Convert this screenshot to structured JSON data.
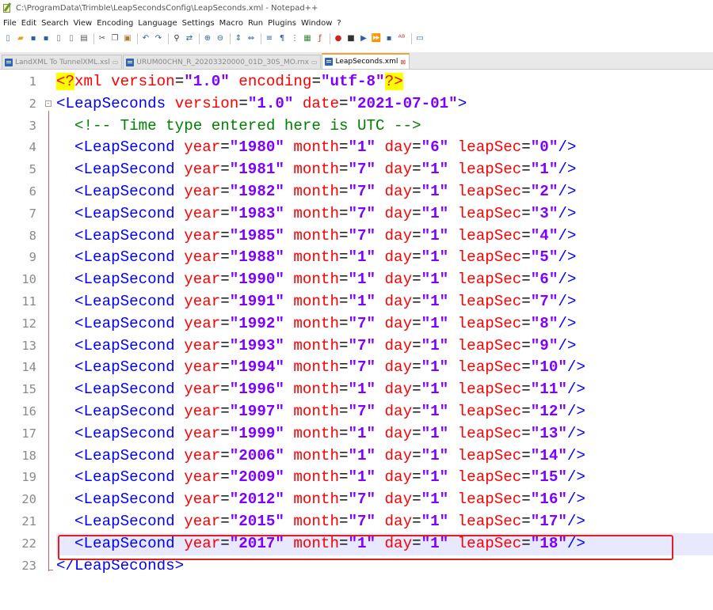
{
  "window": {
    "title": "C:\\ProgramData\\Trimble\\LeapSecondsConfig\\LeapSeconds.xml - Notepad++"
  },
  "menu": [
    "File",
    "Edit",
    "Search",
    "View",
    "Encoding",
    "Language",
    "Settings",
    "Macro",
    "Run",
    "Plugins",
    "Window",
    "?"
  ],
  "toolbar_icons": [
    "new-file-icon",
    "open-file-icon",
    "save-icon",
    "save-all-icon",
    "close-icon",
    "close-all-icon",
    "print-icon",
    "cut-icon",
    "copy-icon",
    "paste-icon",
    "undo-icon",
    "redo-icon",
    "find-icon",
    "replace-icon",
    "zoom-in-icon",
    "zoom-out-icon",
    "sync-vertical-icon",
    "sync-horizontal-icon",
    "word-wrap-icon",
    "show-all-chars-icon",
    "indent-guide-icon",
    "document-map-icon",
    "function-list-icon",
    "record-macro-icon",
    "stop-record-icon",
    "playback-macro-icon",
    "run-macro-multiple-icon",
    "save-macro-icon",
    "spell-check-icon",
    "monitor-icon"
  ],
  "tabs": [
    {
      "label": "LandXML To TunnelXML.xsl",
      "active": false
    },
    {
      "label": "URUM00CHN_R_20203320000_01D_30S_MO.rnx",
      "active": false
    },
    {
      "label": "LeapSeconds.xml",
      "active": true
    }
  ],
  "editor": {
    "xml_decl": {
      "version": "1.0",
      "encoding": "utf-8"
    },
    "root": {
      "name": "LeapSeconds",
      "version": "1.0",
      "date": "2021-07-01"
    },
    "comment": "<!-- Time type entered here is UTC -->",
    "element_name": "LeapSecond",
    "entries": [
      {
        "year": "1980",
        "month": "1",
        "day": "6",
        "leapSec": "0"
      },
      {
        "year": "1981",
        "month": "7",
        "day": "1",
        "leapSec": "1"
      },
      {
        "year": "1982",
        "month": "7",
        "day": "1",
        "leapSec": "2"
      },
      {
        "year": "1983",
        "month": "7",
        "day": "1",
        "leapSec": "3"
      },
      {
        "year": "1985",
        "month": "7",
        "day": "1",
        "leapSec": "4"
      },
      {
        "year": "1988",
        "month": "1",
        "day": "1",
        "leapSec": "5"
      },
      {
        "year": "1990",
        "month": "1",
        "day": "1",
        "leapSec": "6"
      },
      {
        "year": "1991",
        "month": "1",
        "day": "1",
        "leapSec": "7"
      },
      {
        "year": "1992",
        "month": "7",
        "day": "1",
        "leapSec": "8"
      },
      {
        "year": "1993",
        "month": "7",
        "day": "1",
        "leapSec": "9"
      },
      {
        "year": "1994",
        "month": "7",
        "day": "1",
        "leapSec": "10"
      },
      {
        "year": "1996",
        "month": "1",
        "day": "1",
        "leapSec": "11"
      },
      {
        "year": "1997",
        "month": "7",
        "day": "1",
        "leapSec": "12"
      },
      {
        "year": "1999",
        "month": "1",
        "day": "1",
        "leapSec": "13"
      },
      {
        "year": "2006",
        "month": "1",
        "day": "1",
        "leapSec": "14"
      },
      {
        "year": "2009",
        "month": "1",
        "day": "1",
        "leapSec": "15"
      },
      {
        "year": "2012",
        "month": "7",
        "day": "1",
        "leapSec": "16"
      },
      {
        "year": "2015",
        "month": "7",
        "day": "1",
        "leapSec": "17"
      },
      {
        "year": "2017",
        "month": "1",
        "day": "1",
        "leapSec": "18"
      }
    ],
    "current_line": 22,
    "colors": {
      "tag": "#0000ff",
      "attribute": "#ff0000",
      "value": "#8000ff",
      "comment": "#008000",
      "current_line_bg": "#e8e8ff",
      "highlight_box": "#e02020"
    }
  }
}
